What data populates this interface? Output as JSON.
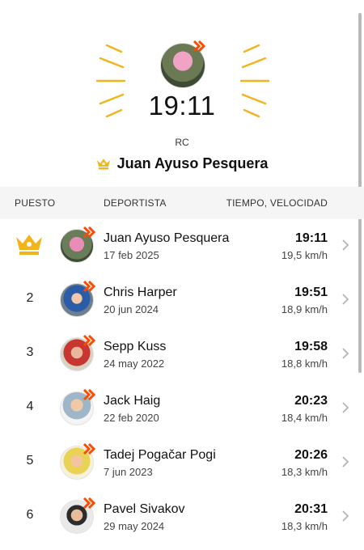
{
  "hero": {
    "time": "19:11",
    "segment": "RC",
    "leader_name": "Juan Ayuso Pesquera"
  },
  "table": {
    "headers": {
      "rank": "PUESTO",
      "athlete": "DEPORTISTA",
      "time_speed": "TIEMPO, VELOCIDAD"
    },
    "rows": [
      {
        "rank": "",
        "crown": true,
        "name": "Juan Ayuso Pesquera",
        "date": "17 feb 2025",
        "time": "19:11",
        "speed": "19,5 km/h"
      },
      {
        "rank": "2",
        "name": "Chris Harper",
        "date": "20 jun 2024",
        "time": "19:51",
        "speed": "18,9 km/h"
      },
      {
        "rank": "3",
        "name": "Sepp Kuss",
        "date": "24 may 2022",
        "time": "19:58",
        "speed": "18,8 km/h"
      },
      {
        "rank": "4",
        "name": "Jack Haig",
        "date": "22 feb 2020",
        "time": "20:23",
        "speed": "18,4 km/h"
      },
      {
        "rank": "5",
        "name": "Tadej Pogačar Pogi",
        "date": "7 jun 2023",
        "time": "20:26",
        "speed": "18,3 km/h"
      },
      {
        "rank": "6",
        "name": "Pavel Sivakov",
        "date": "29 may 2024",
        "time": "20:31",
        "speed": "18,3 km/h"
      }
    ]
  },
  "colors": {
    "crown": "#f2b41b",
    "strava": "#fc4c02",
    "header_bg": "#f5f5f5"
  },
  "icons": {
    "crown": "crown-icon",
    "badge": "strava-badge-icon",
    "chevron": "chevron-right-icon"
  }
}
